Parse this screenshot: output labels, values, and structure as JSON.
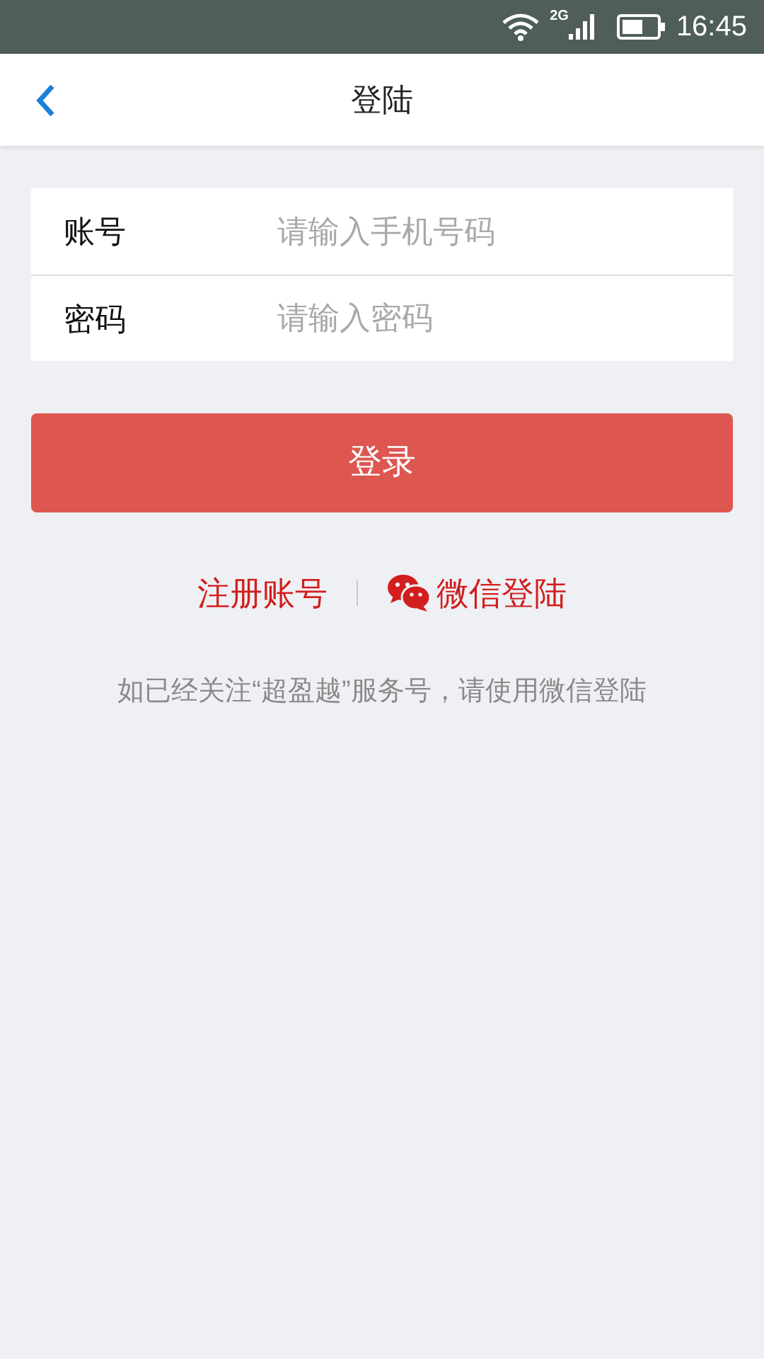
{
  "status_bar": {
    "network": "2G",
    "time": "16:45"
  },
  "header": {
    "title": "登陆"
  },
  "form": {
    "fields": [
      {
        "label": "账号",
        "placeholder": "请输入手机号码"
      },
      {
        "label": "密码",
        "placeholder": "请输入密码"
      }
    ]
  },
  "login_button": "登录",
  "links": {
    "register": "注册账号",
    "wechat": "微信登陆"
  },
  "hint": "如已经关注“超盈越”服务号，请使用微信登陆"
}
